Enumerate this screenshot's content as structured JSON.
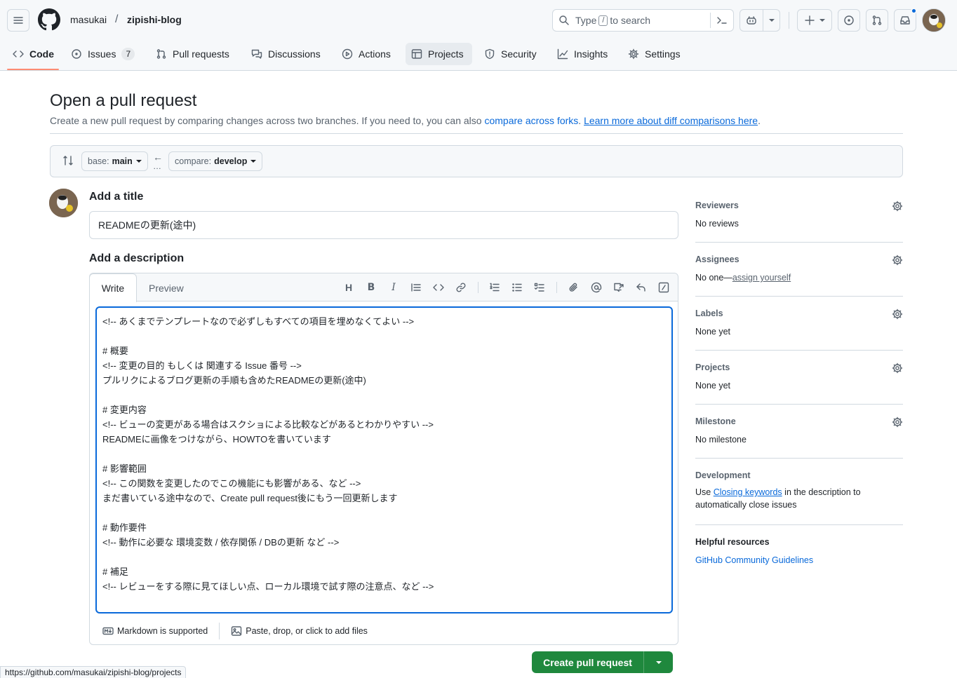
{
  "header": {
    "owner": "masukai",
    "separator": "/",
    "repo": "zipishi-blog",
    "search_prefix": "Type",
    "search_key": "/",
    "search_suffix": "to search"
  },
  "tabs": [
    {
      "label": "Code",
      "icon": "code-icon"
    },
    {
      "label": "Issues",
      "icon": "issue-icon",
      "count": "7"
    },
    {
      "label": "Pull requests",
      "icon": "pull-request-icon"
    },
    {
      "label": "Discussions",
      "icon": "discussions-icon"
    },
    {
      "label": "Actions",
      "icon": "play-icon"
    },
    {
      "label": "Projects",
      "icon": "table-icon"
    },
    {
      "label": "Security",
      "icon": "shield-icon"
    },
    {
      "label": "Insights",
      "icon": "graph-icon"
    },
    {
      "label": "Settings",
      "icon": "gear-icon"
    }
  ],
  "page": {
    "title": "Open a pull request",
    "subtitle_text": "Create a new pull request by comparing changes across two branches. If you need to, you can also",
    "compare_forks": "compare across forks",
    "dot": ".",
    "learn_more": "Learn more about diff comparisons here",
    "period": "."
  },
  "compare": {
    "base_label": "base:",
    "base_value": "main",
    "compare_label": "compare:",
    "compare_value": "develop",
    "arrow": "←",
    "dots": "…"
  },
  "form": {
    "title_heading": "Add a title",
    "title_value": "READMEの更新(途中)",
    "description_heading": "Add a description",
    "tab_write": "Write",
    "tab_preview": "Preview",
    "description_value": "<!-- あくまでテンプレートなので必ずしもすべての項目を埋めなくてよい -->\n\n# 概要\n<!-- 変更の目的 もしくは 関連する Issue 番号 -->\nプルリクによるブログ更新の手順も含めたREADMEの更新(途中)\n\n# 変更内容\n<!-- ビューの変更がある場合はスクショによる比較などがあるとわかりやすい -->\nREADMEに画像をつけながら、HOWTOを書いています\n\n# 影響範囲\n<!-- この関数を変更したのでこの機能にも影響がある、など -->\nまだ書いている途中なので、Create pull request後にもう一回更新します\n\n# 動作要件\n<!-- 動作に必要な 環境変数 / 依存関係 / DBの更新 など -->\n\n# 補足\n<!-- レビューをする際に見てほしい点、ローカル環境で試す際の注意点、など -->",
    "markdown_note": "Markdown is supported",
    "files_note": "Paste, drop, or click to add files",
    "submit_label": "Create pull request"
  },
  "sidebar": {
    "reviewers_label": "Reviewers",
    "reviewers_value": "No reviews",
    "assignees_label": "Assignees",
    "assignees_value": "No one—",
    "assign_yourself": "assign yourself",
    "labels_label": "Labels",
    "labels_value": "None yet",
    "projects_label": "Projects",
    "projects_value": "None yet",
    "milestone_label": "Milestone",
    "milestone_value": "No milestone",
    "development_label": "Development",
    "development_prefix": "Use",
    "closing_keywords": "Closing keywords",
    "development_suffix": "in the description to automatically close issues",
    "helpful_label": "Helpful resources",
    "community_guidelines": "GitHub Community Guidelines"
  },
  "status_url": "https://github.com/masukai/zipishi-blog/projects",
  "colors": {
    "accent": "#0969da",
    "primary_button": "#1f883d",
    "active_tab_underline": "#fd8c73"
  }
}
